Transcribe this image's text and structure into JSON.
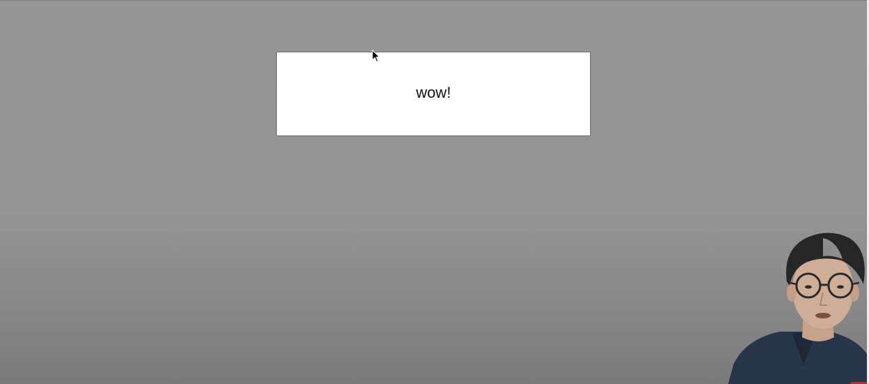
{
  "message": {
    "text": "wow!"
  },
  "colors": {
    "background": "#959595",
    "dialog_background": "#ffffff",
    "dialog_border": "#6d6d6d",
    "text": "#111111"
  },
  "icons": {
    "cursor": "mouse-pointer-icon"
  }
}
